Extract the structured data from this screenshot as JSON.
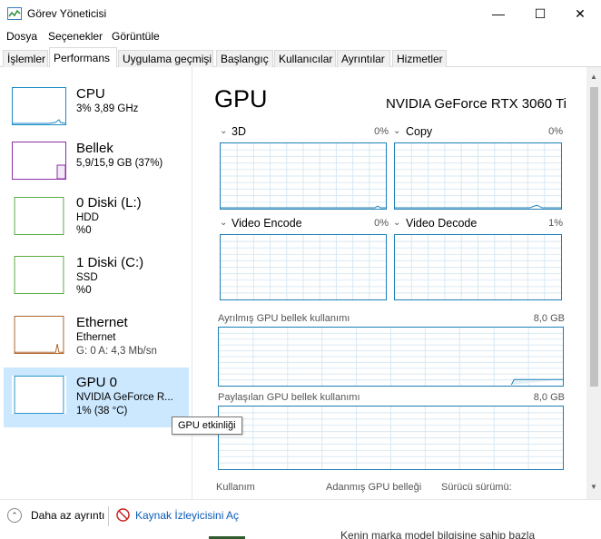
{
  "window": {
    "title": "Görev Yöneticisi",
    "minimize": "—",
    "maximize": "☐",
    "close": "✕"
  },
  "menu": [
    "Dosya",
    "Seçenekler",
    "Görüntüle"
  ],
  "tabs": [
    "İşlemler",
    "Performans",
    "Uygulama geçmişi",
    "Başlangıç",
    "Kullanıcılar",
    "Ayrıntılar",
    "Hizmetler"
  ],
  "active_tab": "Performans",
  "sidebar": [
    {
      "name": "CPU",
      "line1": "3% 3,89 GHz",
      "line2": "",
      "color": "#1a8bc6"
    },
    {
      "name": "Bellek",
      "line1": "5,9/15,9 GB (37%)",
      "line2": "",
      "color": "#8b2fa6"
    },
    {
      "name": "0 Diski (L:)",
      "line1": "HDD",
      "line2": "%0",
      "color": "#4ca530"
    },
    {
      "name": "1 Diski (C:)",
      "line1": "SSD",
      "line2": "%0",
      "color": "#4ca530"
    },
    {
      "name": "Ethernet",
      "line1": "Ethernet",
      "line2": "G: 0 A: 4,3 Mb/sn",
      "color": "#a8571b"
    },
    {
      "name": "GPU 0",
      "line1": "NVIDIA GeForce R...",
      "line2": "1% (38 °C)",
      "color": "#1a8bc6"
    }
  ],
  "main": {
    "title": "GPU",
    "model": "NVIDIA GeForce RTX 3060 Ti",
    "engines": [
      {
        "label": "3D",
        "pct": "0%"
      },
      {
        "label": "Copy",
        "pct": "0%"
      },
      {
        "label": "Video Encode",
        "pct": "0%"
      },
      {
        "label": "Video Decode",
        "pct": "1%"
      }
    ],
    "dedicated_label": "Ayrılmış GPU bellek kullanımı",
    "dedicated_value": "8,0 GB",
    "shared_label": "Paylaşılan GPU bellek kullanımı",
    "shared_value": "8,0 GB",
    "footer": [
      "Kullanım",
      "Adanmış GPU belleği",
      "Sürücü sürümü:"
    ]
  },
  "tooltip": "GPU etkinliği",
  "bottom": {
    "less_details": "Daha az ayrıntı",
    "resource_monitor": "Kaynak İzleyicisini Aç",
    "background_text": "Kenin marka model bilgisine sahip bazla"
  },
  "colors": {
    "accent": "#1c7fb6",
    "selected_bg": "#cce8ff",
    "link": "#0b5bb8"
  }
}
